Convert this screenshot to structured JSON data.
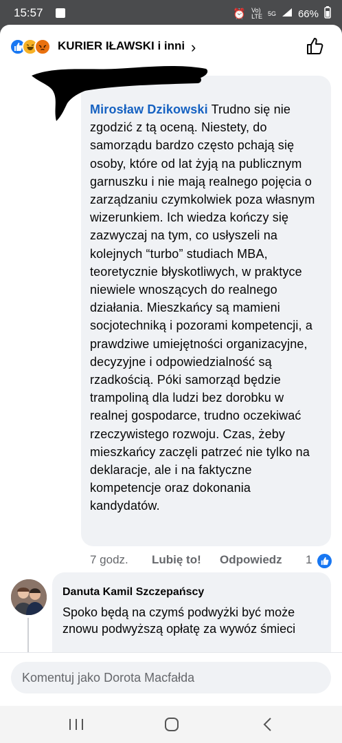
{
  "status_bar": {
    "time": "15:57",
    "network_top": "Vo)",
    "network_bottom": "LTE",
    "signal": "5G",
    "battery": "66%"
  },
  "header": {
    "title": "KURIER IŁAWSKI i inni",
    "chevron": "›",
    "reaction_icons": [
      "like-icon",
      "haha-icon",
      "angry-icon"
    ]
  },
  "comment": {
    "author": "Mirosław Dzikowski",
    "text": "Trudno się nie zgodzić z tą oceną. Niestety, do samorządu bardzo często pchają się osoby, które od lat żyją na publicznym garnuszku i nie mają realnego pojęcia o zarządzaniu czymkolwiek poza własnym wizerunkiem. Ich wiedza kończy się zazwyczaj na tym, co usłyszeli na kolejnych “turbo” studiach MBA, teoretycznie błyskotliwych, w praktyce niewiele wnoszących do realnego działania. Mieszkańcy są mamieni socjotechniką i pozorami kompetencji, a prawdziwe umiejętności organizacyjne, decyzyjne i odpowiedzialność są rzadkością. Póki samorząd będzie trampoliną dla ludzi bez dorobku w realnej gospodarce, trudno oczekiwać rzeczywistego rozwoju. Czas, żeby mieszkańcy zaczęli patrzeć nie tylko na deklaracje, ale i na faktyczne kompetencje oraz dokonania kandydatów.",
    "time": "7 godz.",
    "like_label": "Lubię to!",
    "reply_label": "Odpowiedz",
    "reaction_count": "1"
  },
  "reply": {
    "author": "Danuta Kamil Szczepańscy",
    "text": "Spoko będą na czymś podwyżki być może znowu podwyższą opłatę za wywóz śmieci"
  },
  "composer": {
    "placeholder": "Komentuj jako Dorota Macfałda"
  },
  "colors": {
    "accent": "#1877f2",
    "author_link": "#1561c1",
    "bubble": "#f0f2f5",
    "meta_text": "#65676b"
  }
}
